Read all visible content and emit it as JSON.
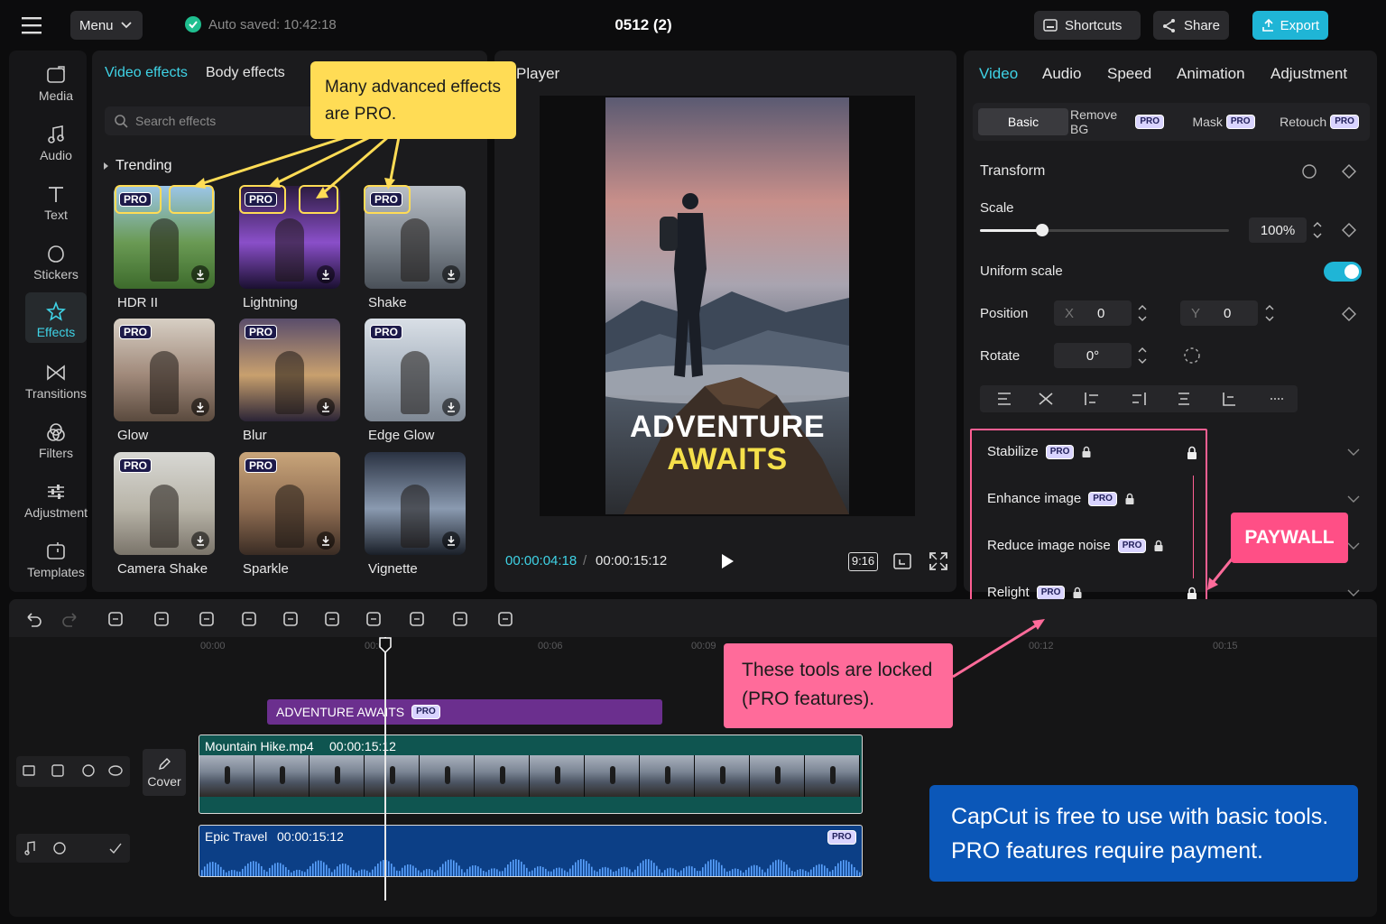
{
  "topbar": {
    "menu_label": "Menu",
    "autosave": "Auto saved: 10:42:18",
    "project_title": "0512 (2)",
    "shortcuts_label": "Shortcuts",
    "share_label": "Share",
    "export_label": "Export"
  },
  "sidebar": {
    "items": [
      {
        "label": "Media"
      },
      {
        "label": "Audio"
      },
      {
        "label": "Text"
      },
      {
        "label": "Stickers"
      },
      {
        "label": "Effects"
      },
      {
        "label": "Transitions"
      },
      {
        "label": "Filters"
      },
      {
        "label": "Adjustment"
      },
      {
        "label": "Templates"
      }
    ]
  },
  "effects": {
    "tab_video": "Video effects",
    "tab_body": "Body effects",
    "search_placeholder": "Search effects",
    "section": "Trending",
    "pro_badge": "PRO",
    "items": [
      {
        "name": "HDR II",
        "pro": true
      },
      {
        "name": "Lightning",
        "pro": true
      },
      {
        "name": "Shake",
        "pro": true
      },
      {
        "name": "Glow",
        "pro": true
      },
      {
        "name": "Blur",
        "pro": true
      },
      {
        "name": "Edge Glow",
        "pro": true
      },
      {
        "name": "Camera Shake",
        "pro": true
      },
      {
        "name": "Sparkle",
        "pro": true
      },
      {
        "name": "Vignette",
        "pro": false
      }
    ]
  },
  "player": {
    "title": "Player",
    "overlay_line1": "ADVENTURE",
    "overlay_line2": "AWAITS",
    "current_time": "00:00:04:18",
    "separator": "/",
    "total_time": "00:00:15:12",
    "ratio": "9:16"
  },
  "inspector": {
    "tabs": [
      "Video",
      "Audio",
      "Speed",
      "Animation",
      "Adjustment"
    ],
    "subtabs": [
      {
        "label": "Basic",
        "pro": false
      },
      {
        "label": "Remove BG",
        "pro": true
      },
      {
        "label": "Mask",
        "pro": true
      },
      {
        "label": "Retouch",
        "pro": true
      }
    ],
    "transform": "Transform",
    "scale_label": "Scale",
    "scale_value": "100%",
    "scale_fraction": 0.25,
    "uniform_label": "Uniform scale",
    "uniform_on": true,
    "position_label": "Position",
    "x_label": "X",
    "x_value": "0",
    "y_label": "Y",
    "y_value": "0",
    "rotate_label": "Rotate",
    "rotate_value": "0°",
    "locked": [
      "Stabilize",
      "Enhance image",
      "Reduce image noise",
      "Relight"
    ]
  },
  "timeline": {
    "ruler": [
      "00:00",
      "00:03",
      "00:06",
      "00:09",
      "00:12",
      "00:15"
    ],
    "text_clip": "ADVENTURE AWAITS",
    "video_name": "Mountain Hike.mp4",
    "video_duration": "00:00:15:12",
    "audio_name": "Epic Travel",
    "audio_duration": "00:00:15:12",
    "cover_label": "Cover"
  },
  "annotations": {
    "effects_callout": "Many advanced effects are PRO.",
    "paywall": "PAYWALL",
    "locked_callout": "These tools are locked (PRO features).",
    "free_note": "CapCut is free to use with basic tools. PRO features require payment."
  },
  "colors": {
    "accent": "#3fd3e6",
    "export": "#1fb5d6",
    "callout_yellow": "#ffdc55",
    "callout_pink": "#ff6b9a",
    "note_blue": "#0b57b8",
    "text_clip": "#6b2f8e",
    "video_clip": "#0f5550",
    "audio_clip": "#0c3f86"
  }
}
